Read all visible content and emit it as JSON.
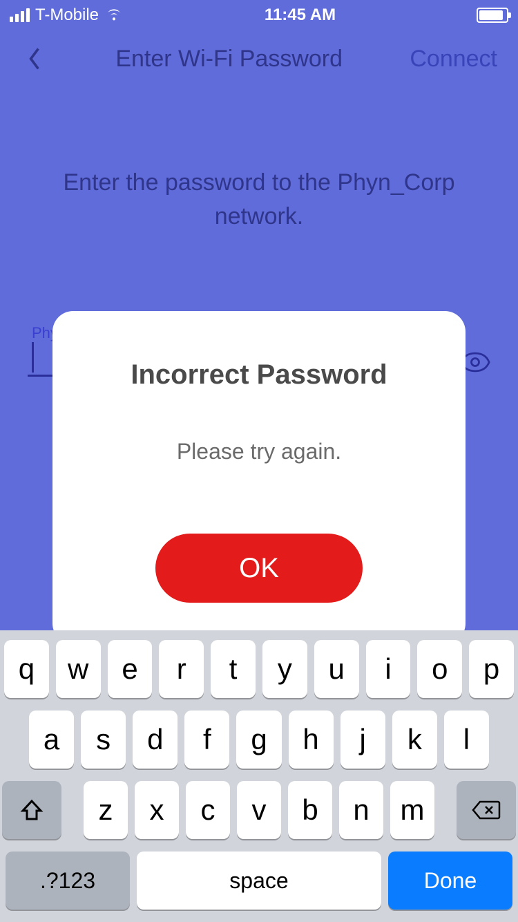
{
  "statusbar": {
    "carrier": "T-Mobile",
    "time": "11:45 AM"
  },
  "navbar": {
    "title": "Enter Wi-Fi Password",
    "action": "Connect"
  },
  "instruction": "Enter the password to the Phyn_Corp network.",
  "input": {
    "label": "Phy",
    "value": ""
  },
  "modal": {
    "title": "Incorrect Password",
    "message": "Please try again.",
    "ok_label": "OK"
  },
  "keyboard": {
    "row1": [
      "q",
      "w",
      "e",
      "r",
      "t",
      "y",
      "u",
      "i",
      "o",
      "p"
    ],
    "row2": [
      "a",
      "s",
      "d",
      "f",
      "g",
      "h",
      "j",
      "k",
      "l"
    ],
    "row3": [
      "z",
      "x",
      "c",
      "v",
      "b",
      "n",
      "m"
    ],
    "symbols_label": ".?123",
    "space_label": "space",
    "done_label": "Done"
  }
}
